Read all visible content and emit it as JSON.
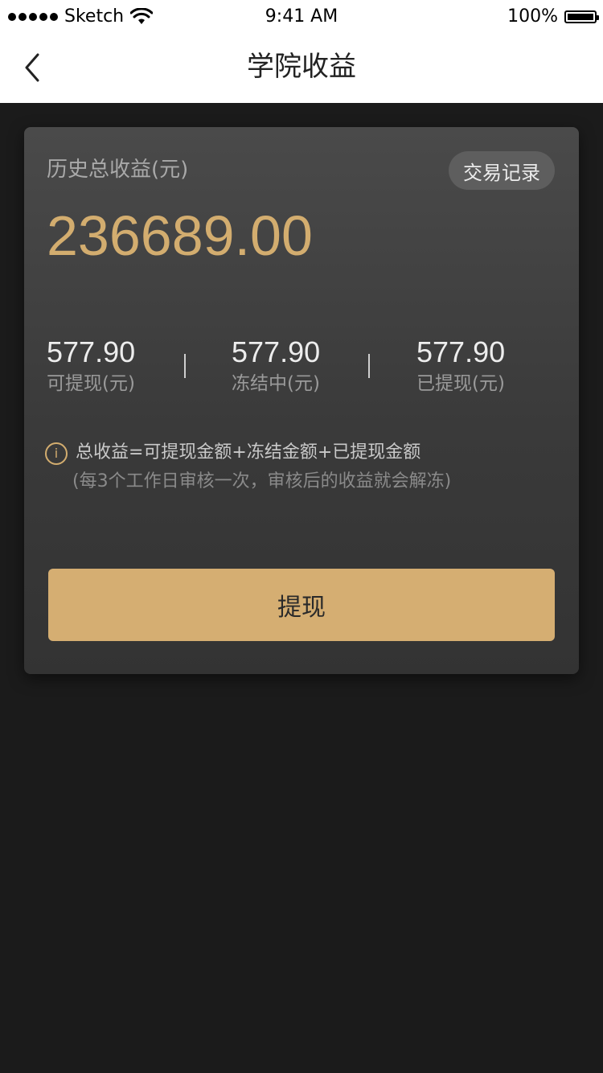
{
  "status_bar": {
    "carrier": "Sketch",
    "time": "9:41 AM",
    "battery": "100%"
  },
  "nav": {
    "title": "学院收益"
  },
  "earnings": {
    "label": "历史总收益(元)",
    "records_button": "交易记录",
    "total": "236689.00",
    "stats": [
      {
        "value": "577.90",
        "label": "可提现(元)"
      },
      {
        "value": "577.90",
        "label": "冻结中(元)"
      },
      {
        "value": "577.90",
        "label": "已提现(元)"
      }
    ],
    "note_line1": "总收益=可提现金额+冻结金额+已提现金额",
    "note_line2": "(每3个工作日审核一次，审核后的收益就会解冻)",
    "info_icon_glyph": "i",
    "withdraw_button": "提现"
  },
  "colors": {
    "accent": "#d3ad6f",
    "background": "#1b1b1b",
    "card": "#3c3c3c"
  },
  "icons": {
    "back": "chevron-left-icon",
    "info": "info-icon",
    "wifi": "wifi-icon",
    "battery": "battery-icon",
    "signal": "signal-icon"
  }
}
